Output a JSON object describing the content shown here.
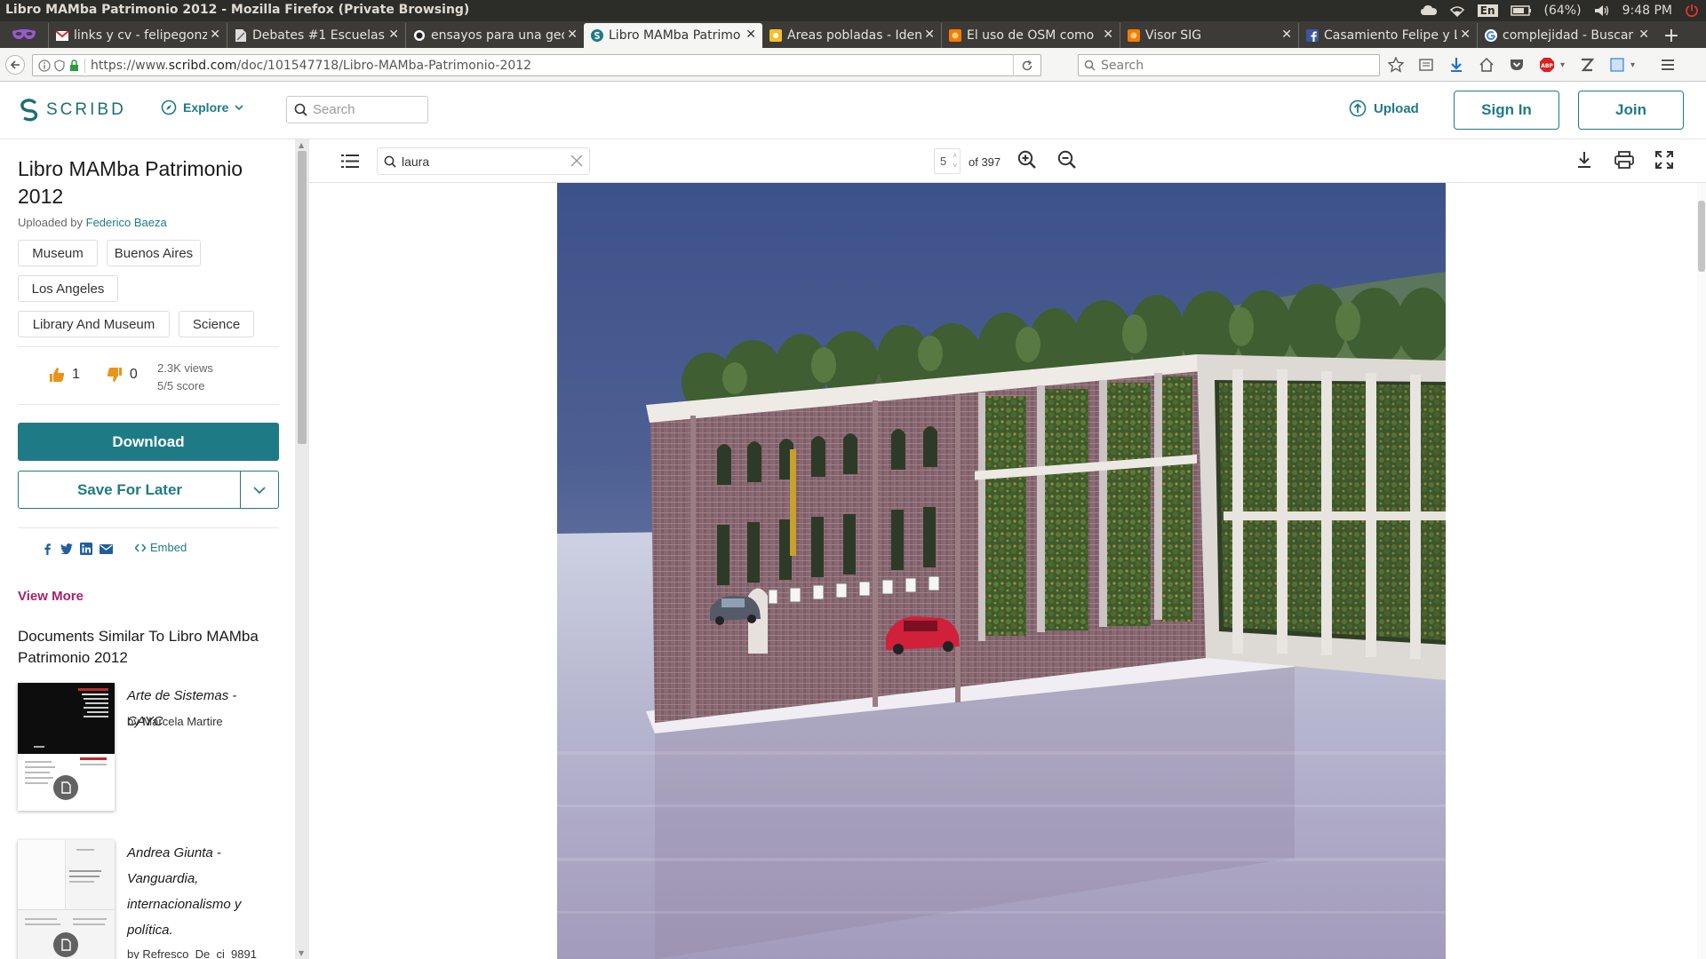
{
  "window": {
    "title": "Libro MAMba Patrimonio 2012 - Mozilla Firefox (Private Browsing)"
  },
  "tray": {
    "kbd": "En",
    "battery": "(64%)",
    "time": "9:48 PM"
  },
  "tabs": [
    {
      "label": "links y cv - felipegonz",
      "icon": "gmail-icon",
      "active": false
    },
    {
      "label": "Debates #1 Escuelas",
      "icon": "page-icon",
      "active": false
    },
    {
      "label": "ensayos para una geo",
      "icon": "medium-icon",
      "active": false
    },
    {
      "label": "Libro MAMba Patrimo",
      "icon": "scribd-icon",
      "active": true
    },
    {
      "label": "Áreas pobladas - Iden",
      "icon": "yellow-site-icon",
      "active": false
    },
    {
      "label": "El uso de OSM como",
      "icon": "orange-site-icon",
      "active": false
    },
    {
      "label": "Visor SIG",
      "icon": "orange-site-icon",
      "active": false
    },
    {
      "label": "Casamiento Felipe y L",
      "icon": "facebook-icon",
      "active": false
    },
    {
      "label": "complejidad - Buscar",
      "icon": "google-icon",
      "active": false
    }
  ],
  "url": {
    "prefix": "https://www.",
    "domain": "scribd.com",
    "path": "/doc/101547718/Libro-MAMba-Patrimonio-2012"
  },
  "browser_search": {
    "placeholder": "Search"
  },
  "header": {
    "logo": "SCRIBD",
    "explore": "Explore",
    "search_placeholder": "Search",
    "upload": "Upload",
    "signin": "Sign In",
    "join": "Join"
  },
  "doc": {
    "title": "Libro MAMba Patrimonio 2012",
    "uploaded_prefix": "Uploaded by",
    "uploader": "Federico Baeza",
    "tags": [
      "Museum",
      "Buenos Aires",
      "Los Angeles",
      "Library And Museum",
      "Science"
    ],
    "likes": "1",
    "dislikes": "0",
    "views": "2.3K views",
    "score": "5/5 score",
    "download": "Download",
    "save": "Save For Later",
    "embed": "Embed",
    "view_more": "View More",
    "similar_heading": "Documents Similar To Libro MAMba Patrimonio 2012",
    "similar": [
      {
        "title": "Arte de Sistemas - CAYC",
        "by": "by Marcela Martire"
      },
      {
        "title": "Andrea Giunta - Vanguardia, internacionalismo y política.",
        "by": "by Refresco_De_ci_9891"
      }
    ]
  },
  "viewer": {
    "search_value": "laura",
    "page": "5",
    "of_pages": "of 397"
  },
  "colors": {
    "brand": "#1e7b85",
    "view_more": "#a3226e",
    "like": "#e8941a"
  }
}
